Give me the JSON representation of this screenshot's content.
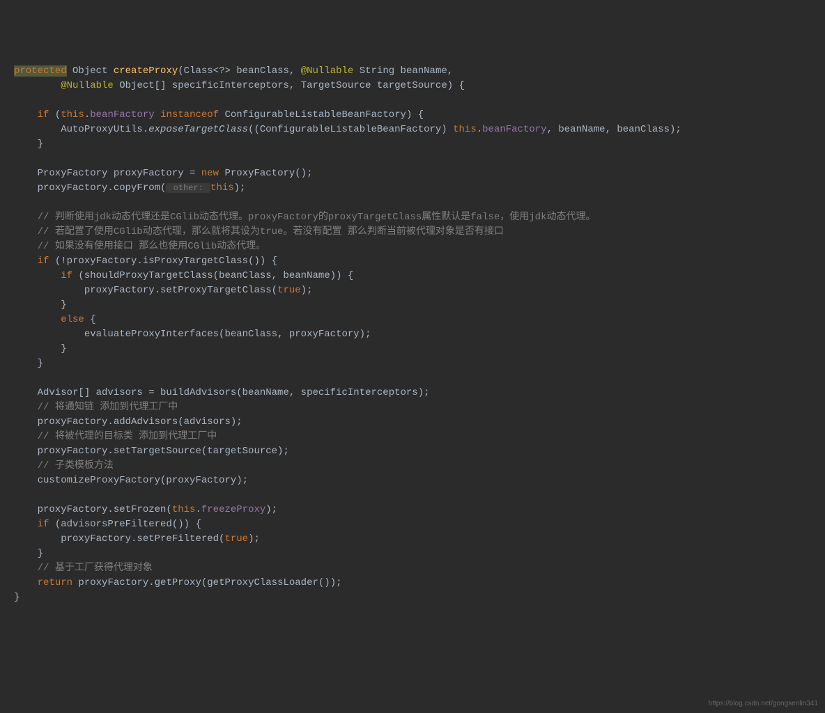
{
  "code": {
    "line1": {
      "protected": "protected",
      "object": " Object ",
      "createProxy": "createProxy",
      "params1": "(Class<?> beanClass, ",
      "nullable": "@Nullable",
      "params2": " String beanName,"
    },
    "line2": {
      "indent": "        ",
      "nullable": "@Nullable",
      "params": " Object[] specificInterceptors, TargetSource targetSource) {"
    },
    "line4": {
      "indent": "    ",
      "if": "if",
      "paren1": " (",
      "this": "this",
      "dot": ".",
      "beanFactory": "beanFactory",
      "space": " ",
      "instanceof": "instanceof",
      "rest": " ConfigurableListableBeanFactory) {"
    },
    "line5": {
      "indent": "        AutoProxyUtils.",
      "method": "exposeTargetClass",
      "paren": "((ConfigurableListableBeanFactory) ",
      "this": "this",
      "dot": ".",
      "beanFactory": "beanFactory",
      "rest": ", beanName, beanClass);"
    },
    "line6": {
      "indent": "    ",
      "brace": "}"
    },
    "line8": {
      "text": "    ProxyFactory proxyFactory = ",
      "new": "new",
      "rest": " ProxyFactory();"
    },
    "line9": {
      "text": "    proxyFactory.copyFrom(",
      "hint": " other: ",
      "this": "this",
      "rest": ");"
    },
    "line11": {
      "indent": "    ",
      "comment": "// 判断使用jdk动态代理还是CGlib动态代理。proxyFactory的proxyTargetClass属性默认是false，使用jdk动态代理。"
    },
    "line12": {
      "indent": "    ",
      "comment": "// 若配置了使用CGlib动态代理，那么就将其设为true。若没有配置 那么判断当前被代理对象是否有接口"
    },
    "line13": {
      "indent": "    ",
      "comment": "// 如果没有使用接口 那么也使用CGlib动态代理。"
    },
    "line14": {
      "indent": "    ",
      "if": "if",
      "rest": " (!proxyFactory.isProxyTargetClass()) {"
    },
    "line15": {
      "indent": "        ",
      "if": "if",
      "rest": " (shouldProxyTargetClass(beanClass, beanName)) {"
    },
    "line16": {
      "indent": "            proxyFactory.setProxyTargetClass(",
      "true": "true",
      "rest": ");"
    },
    "line17": {
      "indent": "        ",
      "brace": "}"
    },
    "line18": {
      "indent": "        ",
      "else": "else",
      "rest": " {"
    },
    "line19": {
      "text": "            evaluateProxyInterfaces(beanClass, proxyFactory);"
    },
    "line20": {
      "indent": "        ",
      "brace": "}"
    },
    "line21": {
      "indent": "    ",
      "brace": "}"
    },
    "line23": {
      "text": "    Advisor[] advisors = buildAdvisors(beanName, specificInterceptors);"
    },
    "line24": {
      "indent": "    ",
      "comment": "// 将通知链 添加到代理工厂中"
    },
    "line25": {
      "text": "    proxyFactory.addAdvisors(advisors);"
    },
    "line26": {
      "indent": "    ",
      "comment": "// 将被代理的目标类 添加到代理工厂中"
    },
    "line27": {
      "text": "    proxyFactory.setTargetSource(targetSource);"
    },
    "line28": {
      "indent": "    ",
      "comment": "// 子类模板方法"
    },
    "line29": {
      "text": "    customizeProxyFactory(proxyFactory);"
    },
    "line31": {
      "text": "    proxyFactory.setFrozen(",
      "this": "this",
      "dot": ".",
      "freezeProxy": "freezeProxy",
      "rest": ");"
    },
    "line32": {
      "indent": "    ",
      "if": "if",
      "rest": " (advisorsPreFiltered()) {"
    },
    "line33": {
      "indent": "        proxyFactory.setPreFiltered(",
      "true": "true",
      "rest": ");"
    },
    "line34": {
      "indent": "    ",
      "brace": "}"
    },
    "line35": {
      "indent": "    ",
      "comment": "// 基于工厂获得代理对象"
    },
    "line36": {
      "indent": "    ",
      "return": "return",
      "rest": " proxyFactory.getProxy(getProxyClassLoader());"
    },
    "line37": {
      "brace": "}"
    }
  },
  "watermark": "https://blog.csdn.net/gongsenlin341"
}
